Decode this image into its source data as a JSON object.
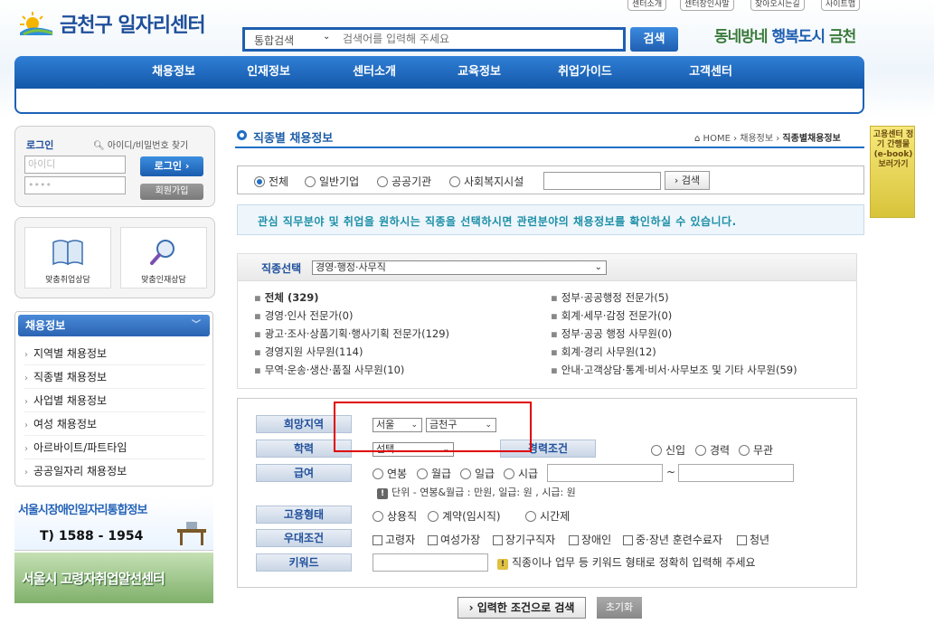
{
  "header": {
    "logo_text": "금천구 일자리센터",
    "top_links": [
      "센터소개",
      "센터장인사말",
      "찾아오시는길",
      "사이트맵"
    ],
    "search": {
      "scope": "통합검색",
      "placeholder": "검색어를 입력해 주세요",
      "button": "검색"
    },
    "slogan_a": "동네방네 ",
    "slogan_b": "행복도시",
    "slogan_c": " 금천"
  },
  "gnb": [
    "채용정보",
    "인재정보",
    "센터소개",
    "교육정보",
    "취업가이드",
    "고객센터"
  ],
  "login": {
    "title": "로그인",
    "find_link": "아이디/비밀번호 찾기",
    "id_placeholder": "아이디",
    "pw_placeholder": "••••",
    "login_button": "로그인 ›",
    "join_button": "회원가입"
  },
  "consult": [
    "맞춤취업상담",
    "맞춤인재상담"
  ],
  "sidebar": {
    "title": "채용정보",
    "items": [
      "지역별 채용정보",
      "직종별 채용정보",
      "사업별 채용정보",
      "여성 채용정보",
      "아르바이트/파트타임",
      "공공일자리 채용정보"
    ]
  },
  "banners": {
    "seoul_title": "서울시장애인일자리통합정보",
    "seoul_phone": "T) 1588 - 1954",
    "senior": "서울시 고령자취업알선센터"
  },
  "ebook_text": "고용센터 정기 간행물 (e-book) 보러가기",
  "page": {
    "title": "직종별 채용정보",
    "breadcrumb_home": "HOME",
    "breadcrumb_mid": "채용정보",
    "breadcrumb_current": "직종별채용정보"
  },
  "filter": {
    "options": [
      "전체",
      "일반기업",
      "공공기관",
      "사회복지시설"
    ],
    "button": "› 검색"
  },
  "notice": "관심 직무분야 및 취업을 원하시는 직종을 선택하시면 관련분야의 채용정보를 확인하실 수 있습니다.",
  "jobcat": {
    "label": "직종선택",
    "selected": "경영·행정·사무직",
    "left": [
      "전체 (329)",
      "경영·인사 전문가(0)",
      "광고·조사·상품기획·행사기획 전문가(129)",
      "경영지원 사무원(114)",
      "무역·운송·생산·품질 사무원(10)"
    ],
    "right": [
      "정부·공공행정 전문가(5)",
      "회계·세무·감정 전문가(0)",
      "정부·공공 행정 사무원(0)",
      "회계·경리 사무원(12)",
      "안내·고객상담·통계·비서·사무보조 및 기타 사무원(59)"
    ]
  },
  "conditions": {
    "region_label": "희망지역",
    "region_city": "서울",
    "region_district": "금천구",
    "edu_label": "학력",
    "edu_value": "선택",
    "career_label": "경력조건",
    "career_options": [
      "신입",
      "경력",
      "무관"
    ],
    "salary_label": "급여",
    "salary_options": [
      "연봉",
      "월급",
      "일급",
      "시급"
    ],
    "salary_sep": "~",
    "salary_note": "단위 - 연봉&월급 : 만원, 일급: 원 , 시급: 원",
    "type_label": "고용형태",
    "type_options": [
      "상용직",
      "계약(임시직)",
      "시간제"
    ],
    "pref_label": "우대조건",
    "pref_options": [
      "고령자",
      "여성가장",
      "장기구직자",
      "장애인",
      "중·장년 훈련수료자",
      "청년"
    ],
    "keyword_label": "키워드",
    "keyword_note": "직종이나 업무 등 키워드 형태로 정확히 입력해 주세요"
  },
  "actions": {
    "submit": "› 입력한 조건으로 검색",
    "reset": "초기화"
  }
}
